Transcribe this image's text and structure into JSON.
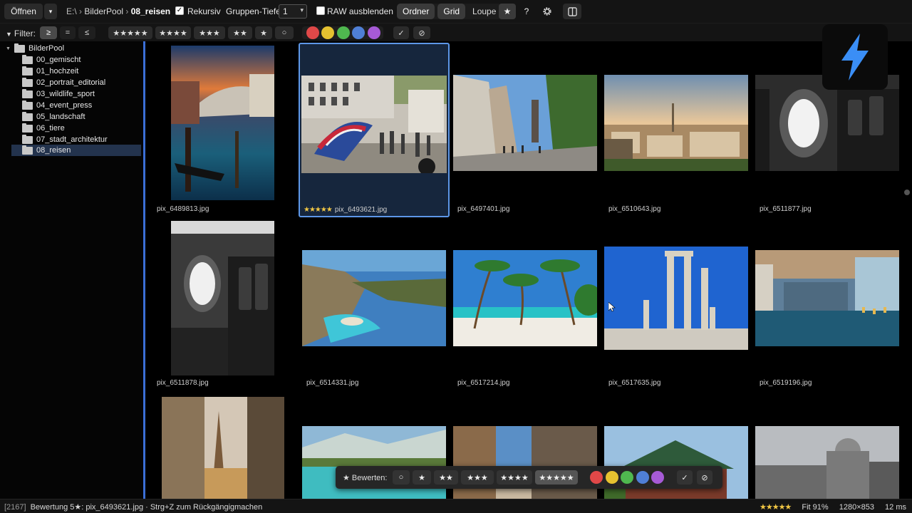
{
  "toolbar": {
    "open_label": "Öffnen",
    "open_dropdown_glyph": "▾",
    "breadcrumb": [
      "E:\\",
      "BilderPool",
      "08_reisen"
    ],
    "breadcrumb_sep": "›",
    "recursive_label": "Rekursiv",
    "recursive_checked": true,
    "group_depth_label": "Gruppen-Tiefe",
    "group_depth_value": "1",
    "raw_hide_label": "RAW ausblenden",
    "raw_hide_checked": false,
    "view_modes": [
      "Ordner",
      "Grid",
      "Loupe"
    ],
    "active_view_mode": "Grid",
    "star_label": "★",
    "help_label": "?",
    "settings_icon": "gear-icon",
    "panel_icon": "panel-toggle-icon"
  },
  "filter": {
    "label": "Filter:",
    "ops": [
      "≥",
      "=",
      "≤"
    ],
    "active_op": "≥",
    "ratings": [
      "★★★★★",
      "★★★★",
      "★★★",
      "★★",
      "★",
      "○"
    ],
    "colors": [
      "#e04848",
      "#e6c230",
      "#4fb84f",
      "#4f7fd6",
      "#a65ad6"
    ],
    "flags": [
      "✓",
      "⊘"
    ]
  },
  "sidebar": {
    "root": "BilderPool",
    "items": [
      "00_gemischt",
      "01_hochzeit",
      "02_portrait_editorial",
      "03_wildlife_sport",
      "04_event_press",
      "05_landschaft",
      "06_tiere",
      "07_stadt_architektur",
      "08_reisen"
    ],
    "selected": "08_reisen"
  },
  "grid": {
    "images": [
      {
        "name": "pix_6489813.jpg",
        "rating": ""
      },
      {
        "name": "pix_6493621.jpg",
        "rating": "★★★★★"
      },
      {
        "name": "pix_6497401.jpg",
        "rating": ""
      },
      {
        "name": "pix_6510643.jpg",
        "rating": ""
      },
      {
        "name": "pix_6511877.jpg",
        "rating": ""
      },
      {
        "name": "pix_6511878.jpg",
        "rating": ""
      },
      {
        "name": "pix_6514331.jpg",
        "rating": ""
      },
      {
        "name": "pix_6517214.jpg",
        "rating": ""
      },
      {
        "name": "pix_6517635.jpg",
        "rating": ""
      },
      {
        "name": "pix_6519196.jpg",
        "rating": ""
      }
    ],
    "selected": "pix_6493621.jpg"
  },
  "rating_bar": {
    "label": "★ Bewerten:",
    "options": [
      "○",
      "★",
      "★★",
      "★★★",
      "★★★★",
      "★★★★★"
    ],
    "active": "★★★★★",
    "colors": [
      "#e04848",
      "#e6c230",
      "#4fb84f",
      "#4f7fd6",
      "#a65ad6"
    ],
    "flags": [
      "✓",
      "⊘"
    ]
  },
  "statusbar": {
    "count": "[2167]",
    "message": "Bewertung 5★: pix_6493621.jpg · Strg+Z zum Rückgängigmachen",
    "rating": "★★★★★",
    "fit": "Fit 91%",
    "dimensions": "1280×853",
    "timing": "12 ms"
  },
  "quick_action": {
    "icon": "lightning-icon",
    "color": "#3a8ef6"
  }
}
